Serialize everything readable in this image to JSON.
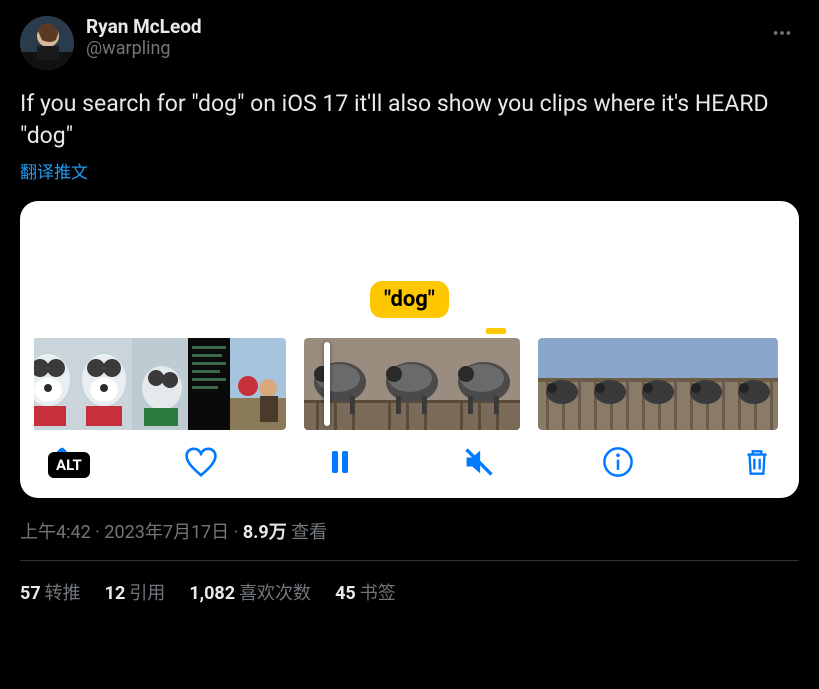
{
  "author": {
    "display_name": "Ryan McLeod",
    "handle": "@warpling"
  },
  "tweet_text": "If you search for \"dog\" on iOS 17 it'll also show you clips where it's HEARD \"dog\"",
  "translate_label": "翻译推文",
  "media": {
    "bubble_text": "\"dog\"",
    "alt_badge": "ALT"
  },
  "meta": {
    "time": "上午4:42",
    "date": "2023年7月17日",
    "views_count": "8.9万",
    "views_label": "查看"
  },
  "stats": {
    "retweets": {
      "count": "57",
      "label": "转推"
    },
    "quotes": {
      "count": "12",
      "label": "引用"
    },
    "likes": {
      "count": "1,082",
      "label": "喜欢次数"
    },
    "bookmarks": {
      "count": "45",
      "label": "书签"
    }
  }
}
